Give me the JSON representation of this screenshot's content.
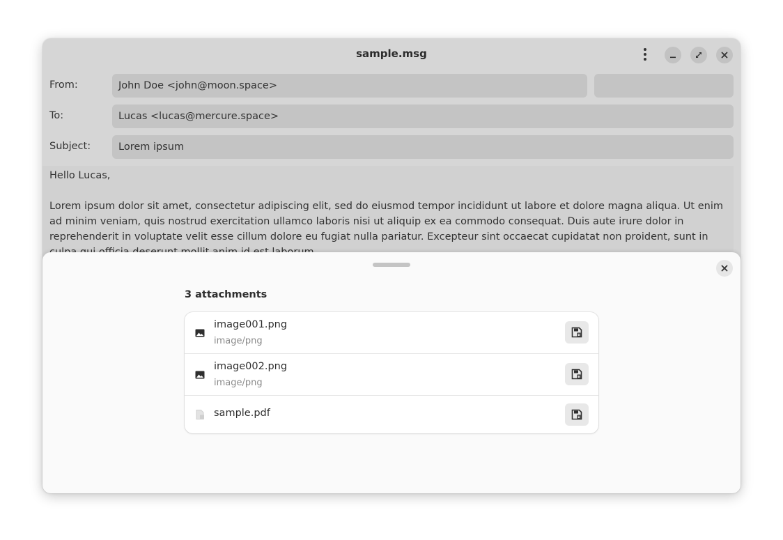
{
  "window": {
    "title": "sample.msg"
  },
  "header": {
    "from_label": "From:",
    "from_value": "John Doe <john@moon.space>",
    "to_label": "To:",
    "to_value": "Lucas <lucas@mercure.space>",
    "subject_label": "Subject:",
    "subject_value": "Lorem ipsum"
  },
  "message": {
    "greeting": "Hello Lucas,",
    "paragraph": "Lorem ipsum dolor sit amet, consectetur adipiscing elit, sed do eiusmod tempor incididunt ut labore et dolore magna aliqua. Ut enim ad minim veniam, quis nostrud exercitation ullamco laboris nisi ut aliquip ex ea commodo consequat. Duis aute irure dolor in reprehenderit in voluptate velit esse cillum dolore eu fugiat nulla pariatur. Excepteur sint occaecat cupidatat non proident, sunt in culpa qui officia deserunt mollit anim id est laborum."
  },
  "attachments": {
    "title": "3 attachments",
    "items": [
      {
        "name": "image001.png",
        "type": "image/png",
        "icon": "image-icon"
      },
      {
        "name": "image002.png",
        "type": "image/png",
        "icon": "image-icon"
      },
      {
        "name": "sample.pdf",
        "type": "",
        "icon": "document-icon"
      }
    ]
  },
  "icons": {
    "menu": "vertical-dots-icon",
    "minimize": "minimize-icon",
    "maximize": "maximize-icon",
    "close": "close-icon",
    "save": "floppy-disk-icon"
  }
}
